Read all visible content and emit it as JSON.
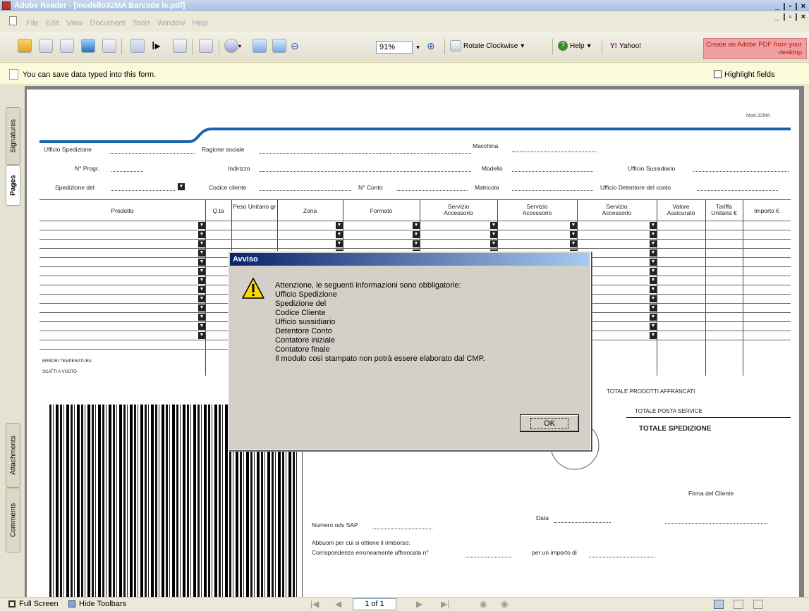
{
  "window": {
    "title": "Adobe Reader - [modello32MA Barcode ls.pdf]",
    "controls": "_ | ▫ | ×"
  },
  "menu": [
    "File",
    "Edit",
    "View",
    "Document",
    "Tools",
    "Window",
    "Help"
  ],
  "toolbar": {
    "zoom": "91%",
    "rotate_label": "Rotate Clockwise",
    "help_label": "Help",
    "yahoo_label": "Yahoo!",
    "adobe_ad": "Create an Adobe PDF from your desktop"
  },
  "infobar": {
    "message": "You can save data typed into this form.",
    "highlight_label": "Highlight fields"
  },
  "left_tabs": [
    "Signatures",
    "Pages",
    "Attachments",
    "Comments"
  ],
  "form": {
    "code": "Mod.32MA",
    "fields": {
      "ufficio_spedizione": "Ufficio Spedizione",
      "ragione_sociale": "Ragione sociale",
      "macchina": "Macchina",
      "n_progr": "N° Progr.",
      "indirizzo": "Indirizzo",
      "modello": "Modello",
      "ufficio_sussidiario": "Ufficio Sussidiario",
      "spedizione_del": "Spedizione del",
      "codice_cliente": "Codice cliente",
      "n_conto": "N° Conto",
      "matricola": "Matricola",
      "ufficio_detentore": "Ufficio Detentore del conto"
    },
    "columns": [
      "Prodotto",
      "Q.ta",
      "Peso Unitario gr",
      "Zona",
      "Formato",
      "Servizio Accessorio",
      "Servizio Accessorio",
      "Servizio Accessorio",
      "Valore Assicurato",
      "Tariffa Unitaria €",
      "Importo €"
    ],
    "bottom_left": [
      "ERRORI TEMPERATURA",
      "SCATTI A VUOTO"
    ],
    "totals": [
      "TOTALE PRODOTTI AFFRANCATI",
      "TOTALE POSTA SERVICE",
      "TOTALE SPEDIZIONE"
    ],
    "firma": "Firma del Cliente",
    "numero_odv": "Numero odv SAP",
    "data": "Data",
    "abbuoni": "Abbuoni per cui si ottiene il rimborso:",
    "corrispondenza": "Corrispondenza erroneamente affrancata n°",
    "importo": "per un importo di"
  },
  "dialog": {
    "title": "Avviso",
    "message": "Attenzione, le seguenti informazioni sono obbligatorie:\nUfficio Spedizione\nSpedizione del\nCodice Cliente\nUfficio sussidiario\nDetentore Conto\nContatore iniziale\nContatore finale\nIl modulo così stampato non potrà essere elaborato dal CMP.",
    "ok_label": "OK"
  },
  "status": {
    "full_screen": "Full Screen",
    "hide_toolbars": "Hide Toolbars",
    "page": "1 of 1"
  }
}
